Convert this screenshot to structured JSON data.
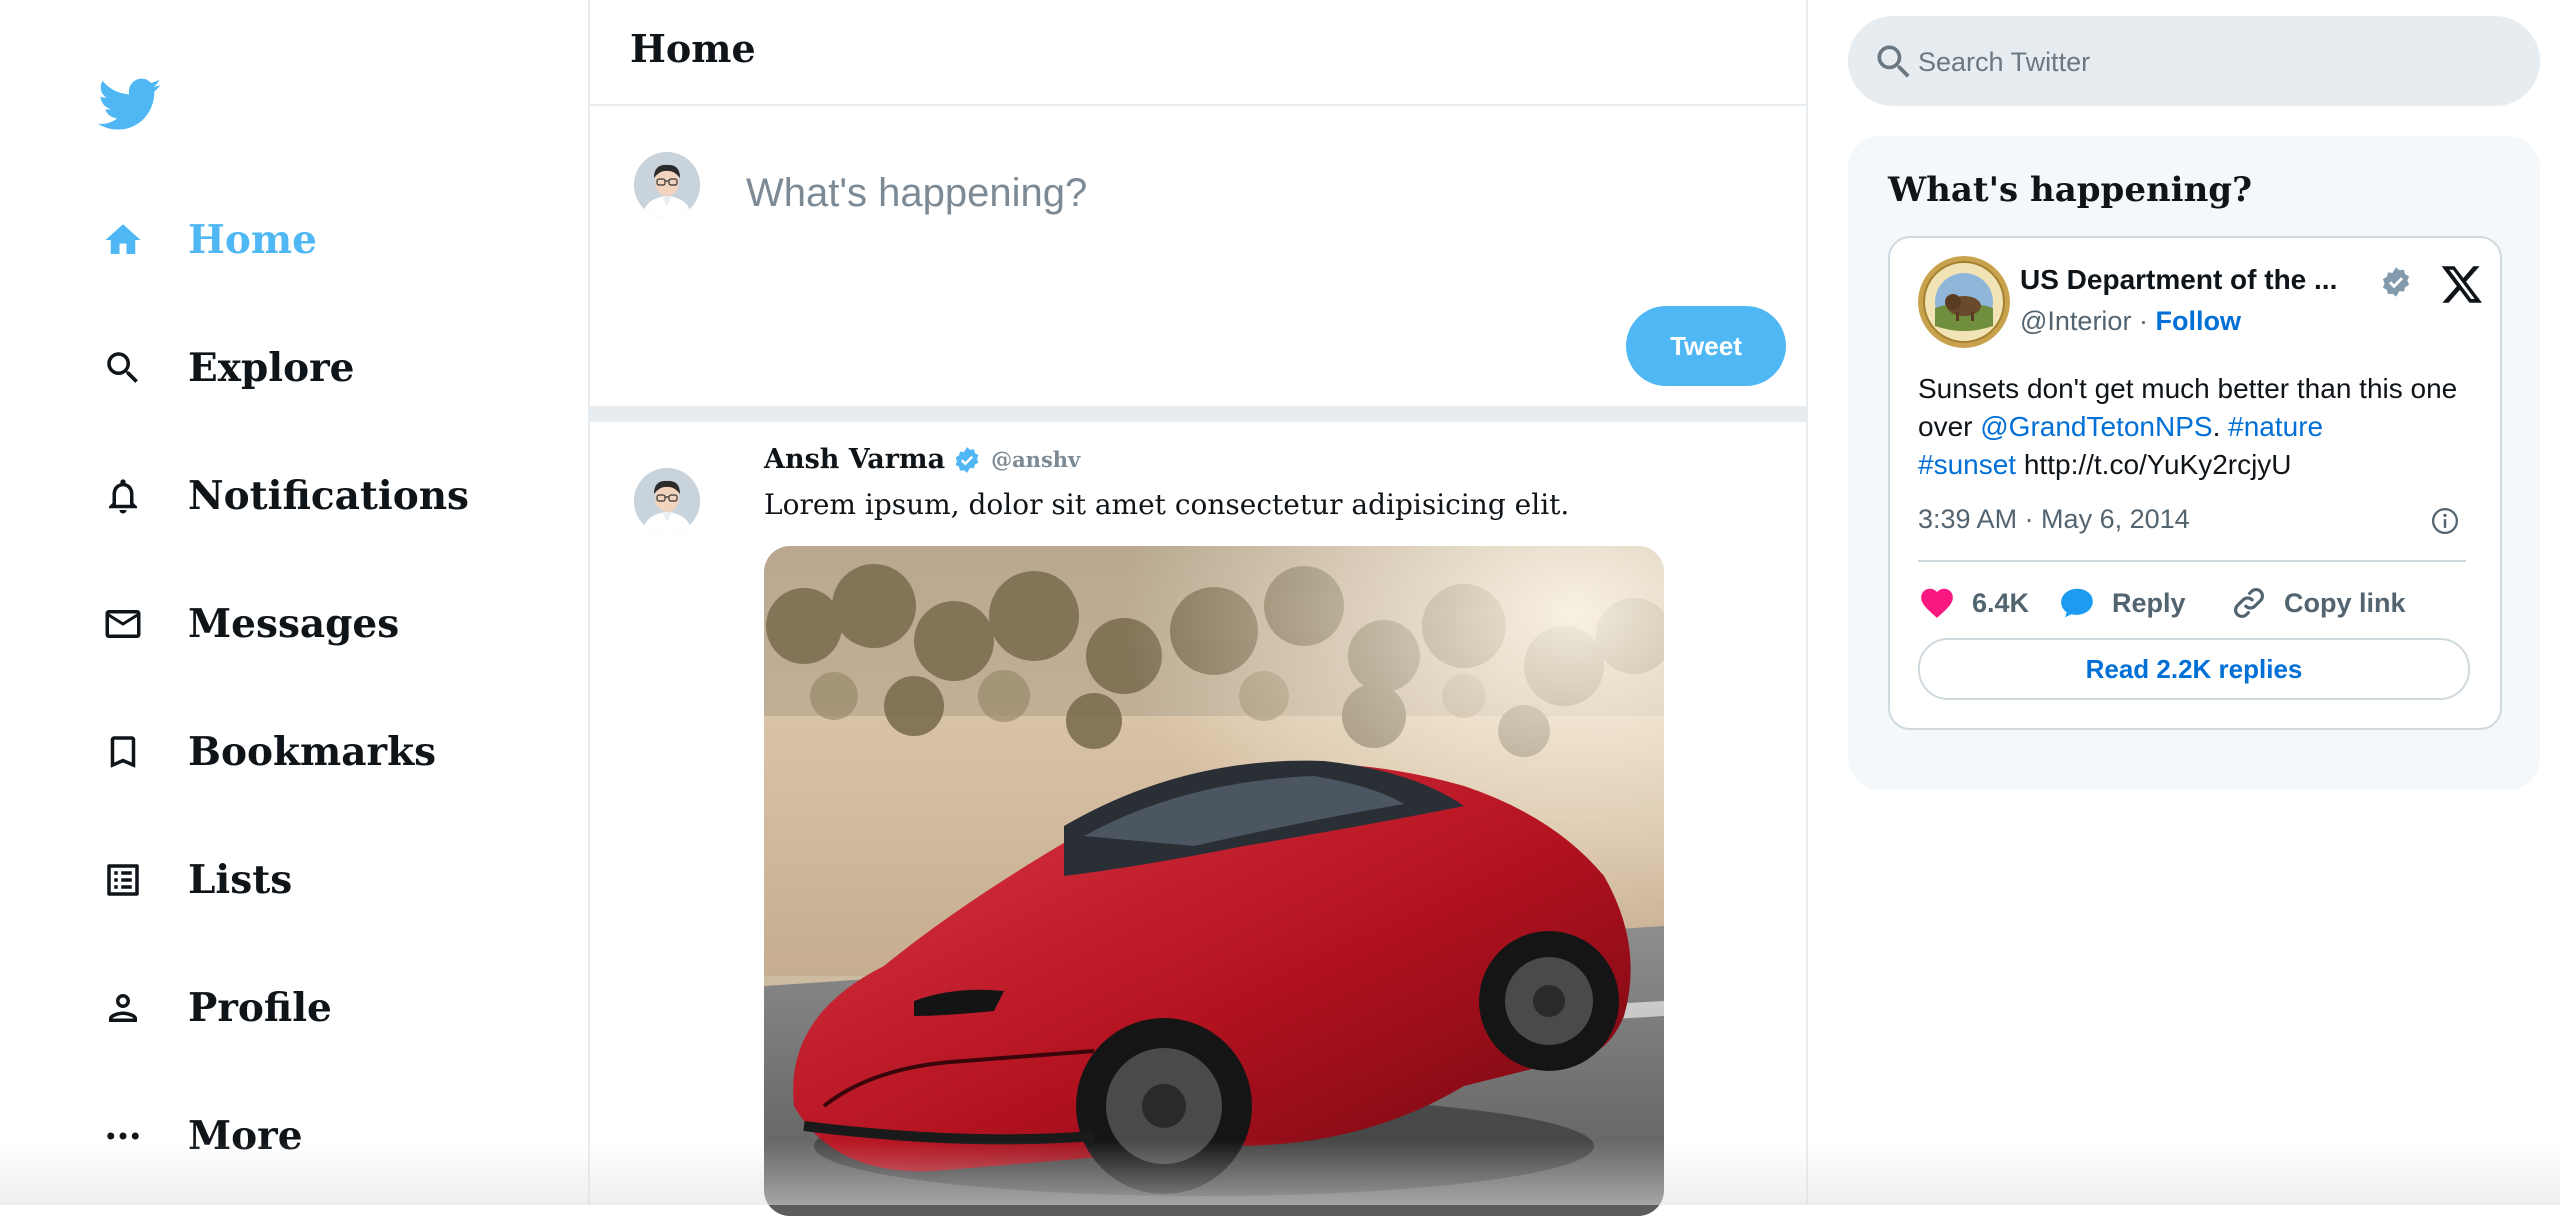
{
  "sidebar": {
    "logo_icon": "twitter-bird-icon",
    "items": [
      {
        "label": "Home",
        "icon": "home-icon",
        "active": true
      },
      {
        "label": "Explore",
        "icon": "search-icon",
        "active": false
      },
      {
        "label": "Notifications",
        "icon": "bell-icon",
        "active": false
      },
      {
        "label": "Messages",
        "icon": "mail-icon",
        "active": false
      },
      {
        "label": "Bookmarks",
        "icon": "bookmark-icon",
        "active": false
      },
      {
        "label": "Lists",
        "icon": "list-icon",
        "active": false
      },
      {
        "label": "Profile",
        "icon": "person-icon",
        "active": false
      },
      {
        "label": "More",
        "icon": "more-icon",
        "active": false
      }
    ]
  },
  "main": {
    "title": "Home",
    "composer": {
      "placeholder": "What's happening?",
      "tweet_button": "Tweet"
    },
    "post": {
      "author": "Ansh Varma",
      "handle": "@anshv",
      "text": "Lorem ipsum, dolor sit amet consectetur adipisicing elit.",
      "image_icon": "red-sports-car-image"
    }
  },
  "right": {
    "search_placeholder": "Search Twitter",
    "widget": {
      "title": "What's happening?",
      "embed": {
        "account_name": "US Department of the ...",
        "account_handle": "@Interior",
        "separator": "·",
        "follow": "Follow",
        "text_1": "Sunsets don't get much better than this one over ",
        "mention": "@GrandTetonNPS",
        "text_2": ". ",
        "hashtag_1": "#nature",
        "hashtag_2": "#sunset",
        "link": "http://t.co/YuKy2rcjyU",
        "timestamp": "3:39 AM · May 6, 2014",
        "likes": "6.4K",
        "reply": "Reply",
        "copy_link": "Copy link",
        "read_replies": "Read 2.2K replies"
      }
    }
  },
  "colors": {
    "accent": "#50b7f5",
    "link": "#006fd6",
    "divider": "#e6ecf0",
    "like": "#f91880"
  }
}
